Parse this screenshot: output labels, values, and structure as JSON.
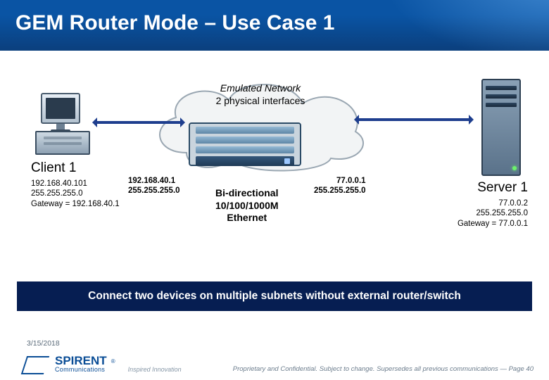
{
  "slide": {
    "title": "GEM Router Mode – Use Case 1",
    "cloud": {
      "line1": "Emulated Network",
      "line2": "2 physical interfaces"
    },
    "client": {
      "label": "Client 1",
      "ip": "192.168.40.101",
      "mask": "255.255.255.0",
      "gateway_label": "Gateway = 192.168.40.1"
    },
    "server": {
      "label": "Server 1",
      "ip": "77.0.0.2",
      "mask": "255.255.255.0",
      "gateway_label": "Gateway = 77.0.0.1"
    },
    "if_left": {
      "ip": "192.168.40.1",
      "mask": "255.255.255.0"
    },
    "if_right": {
      "ip": "77.0.0.1",
      "mask": "255.255.255.0"
    },
    "link": {
      "line1": "Bi-directional",
      "line2": "10/100/1000M",
      "line3": "Ethernet"
    },
    "caption": "Connect two devices on multiple subnets without external router/switch"
  },
  "footer": {
    "date": "3/15/2018",
    "brand_name": "SPIRENT",
    "brand_sub": "Communications",
    "tagline": "Inspired Innovation",
    "legal_prefix": "Proprietary and Confidential.  Subject to change. Supersedes all previous communications — ",
    "page_label": "Page 40"
  }
}
